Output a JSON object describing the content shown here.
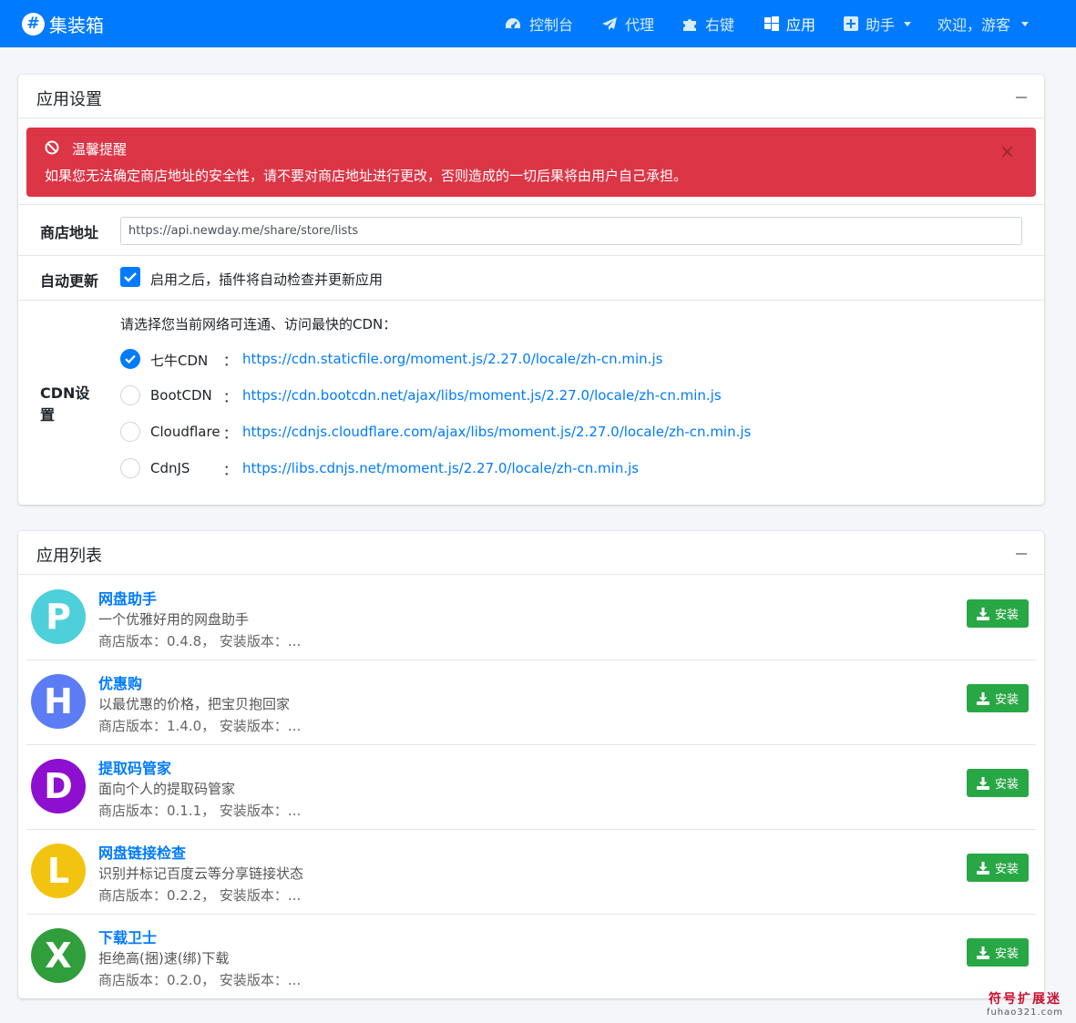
{
  "navbar": {
    "brand_symbol": "#",
    "brand": "集装箱",
    "items": [
      {
        "label": "控制台",
        "icon": "dashboard-icon"
      },
      {
        "label": "代理",
        "icon": "paper-plane-icon"
      },
      {
        "label": "右键",
        "icon": "puzzle-icon"
      },
      {
        "label": "应用",
        "icon": "windows-icon"
      },
      {
        "label": "助手",
        "icon": "plus-square-icon"
      },
      {
        "label": "欢迎，游客",
        "icon": ""
      }
    ]
  },
  "settings": {
    "title": "应用设置",
    "alert": {
      "title": "温馨提醒",
      "text": "如果您无法确定商店地址的安全性，请不要对商店地址进行更改，否则造成的一切后果将由用户自己承担。",
      "close": "×"
    },
    "store_label": "商店地址",
    "store_value": "https://api.newday.me/share/store/lists",
    "auto_label": "自动更新",
    "auto_text": "启用之后，插件将自动检查并更新应用",
    "cdn_label": "CDN设置",
    "cdn_intro": "请选择您当前网络可连通、访问最快的CDN：",
    "cdn_colon": "：",
    "cdns": [
      {
        "name": "七牛CDN",
        "url": "https://cdn.staticfile.org/moment.js/2.27.0/locale/zh-cn.min.js",
        "selected": true
      },
      {
        "name": "BootCDN",
        "url": "https://cdn.bootcdn.net/ajax/libs/moment.js/2.27.0/locale/zh-cn.min.js",
        "selected": false
      },
      {
        "name": "Cloudflare",
        "url": "https://cdnjs.cloudflare.com/ajax/libs/moment.js/2.27.0/locale/zh-cn.min.js",
        "selected": false
      },
      {
        "name": "CdnJS",
        "url": "https://libs.cdnjs.net/moment.js/2.27.0/locale/zh-cn.min.js",
        "selected": false
      }
    ]
  },
  "applist": {
    "title": "应用列表",
    "install_label": "安装",
    "apps": [
      {
        "letter": "P",
        "color": "#4dd0d9",
        "name": "网盘助手",
        "desc": "一个优雅好用的网盘助手",
        "ver": "商店版本：0.4.8， 安装版本：..."
      },
      {
        "letter": "H",
        "color": "#5b7cf5",
        "name": "优惠购",
        "desc": "以最优惠的价格，把宝贝抱回家",
        "ver": "商店版本：1.4.0， 安装版本：..."
      },
      {
        "letter": "D",
        "color": "#8e0fcf",
        "name": "提取码管家",
        "desc": "面向个人的提取码管家",
        "ver": "商店版本：0.1.1， 安装版本：..."
      },
      {
        "letter": "L",
        "color": "#f2c40f",
        "name": "网盘链接检查",
        "desc": "识别并标记百度云等分享链接状态",
        "ver": "商店版本：0.2.2， 安装版本：..."
      },
      {
        "letter": "X",
        "color": "#2f9e3b",
        "name": "下载卫士",
        "desc": "拒绝高(捆)速(绑)下载",
        "ver": "商店版本：0.2.0， 安装版本：..."
      }
    ]
  },
  "watermark": {
    "line1": "符号扩展迷",
    "line2": "fuhao321.com"
  }
}
